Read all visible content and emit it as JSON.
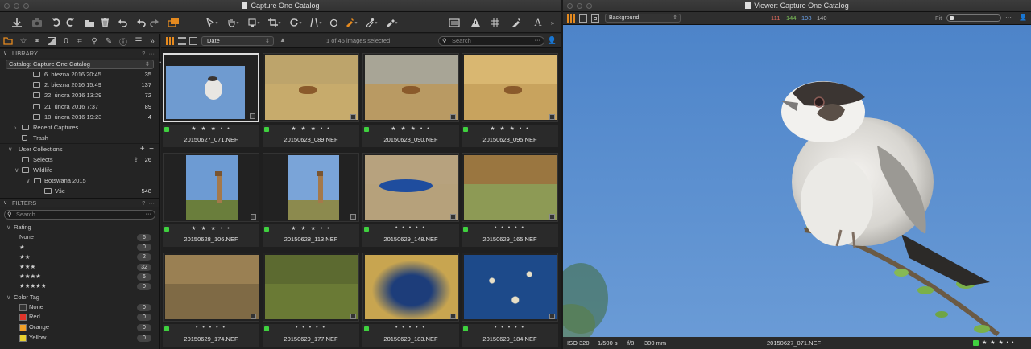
{
  "browser_window": {
    "title": "Capture One Catalog",
    "library": {
      "header": "LIBRARY",
      "catalog_selector": "Catalog: Capture One Catalog",
      "imports": [
        {
          "label": "6. března 2016 20:45",
          "count": "35"
        },
        {
          "label": "2. března 2016 15:49",
          "count": "137"
        },
        {
          "label": "22. února 2016 13:29",
          "count": "72"
        },
        {
          "label": "21. února 2016 7:37",
          "count": "89"
        },
        {
          "label": "18. února 2016 19:23",
          "count": "4"
        }
      ],
      "recent_captures": "Recent Captures",
      "trash": "Trash",
      "user_collections": "User Collections",
      "selects": {
        "label": "Selects",
        "count": "26"
      },
      "wildlife": "Wildlife",
      "botswana": "Botswana 2015",
      "vse": {
        "label": "Vše",
        "count": "548"
      }
    },
    "filters": {
      "header": "FILTERS",
      "search_placeholder": "Search",
      "rating_header": "Rating",
      "rating_rows": [
        {
          "label": "None",
          "count": "6"
        },
        {
          "label": "★",
          "count": "0"
        },
        {
          "label": "★★",
          "count": "2"
        },
        {
          "label": "★★★",
          "count": "32"
        },
        {
          "label": "★★★★",
          "count": "6"
        },
        {
          "label": "★★★★★",
          "count": "0"
        }
      ],
      "colortag_header": "Color Tag",
      "color_rows": [
        {
          "label": "None",
          "count": "0",
          "color": "#333333"
        },
        {
          "label": "Red",
          "count": "0",
          "color": "#e0342a"
        },
        {
          "label": "Orange",
          "count": "0",
          "color": "#f0a028"
        },
        {
          "label": "Yellow",
          "count": "0",
          "color": "#e8d030"
        }
      ]
    },
    "browser": {
      "sort": "Date",
      "count_text": "1 of 46 images selected",
      "search_placeholder": "Search",
      "thumbs": [
        {
          "name": "20150627_071.NEF",
          "rating": "★ ★ ★ • •"
        },
        {
          "name": "20150628_089.NEF",
          "rating": "★ ★ ★ • •"
        },
        {
          "name": "20150628_090.NEF",
          "rating": "★ ★ ★ • •"
        },
        {
          "name": "20150628_095.NEF",
          "rating": "★ ★ ★ • •"
        },
        {
          "name": "20150628_106.NEF",
          "rating": "★ ★ ★ • •"
        },
        {
          "name": "20150628_113.NEF",
          "rating": "★ ★ ★ • •"
        },
        {
          "name": "20150629_148.NEF",
          "rating": "• • • • •"
        },
        {
          "name": "20150629_165.NEF",
          "rating": "• • • • •"
        },
        {
          "name": "20150629_174.NEF",
          "rating": "• • • • •"
        },
        {
          "name": "20150629_177.NEF",
          "rating": "• • • • •"
        },
        {
          "name": "20150629_183.NEF",
          "rating": "• • • • •"
        },
        {
          "name": "20150629_184.NEF",
          "rating": "• • • • •"
        }
      ]
    }
  },
  "viewer_window": {
    "title": "Viewer: Capture One Catalog",
    "background_select": "Background",
    "rgb": {
      "r": "111",
      "g": "144",
      "b": "198",
      "l": "140"
    },
    "fit_label": "Fit",
    "status": {
      "iso": "ISO 320",
      "shutter": "1/500 s",
      "aperture": "f/8",
      "focal": "300 mm",
      "filename": "20150627_071.NEF",
      "rating": "★ ★ ★ • •"
    }
  }
}
